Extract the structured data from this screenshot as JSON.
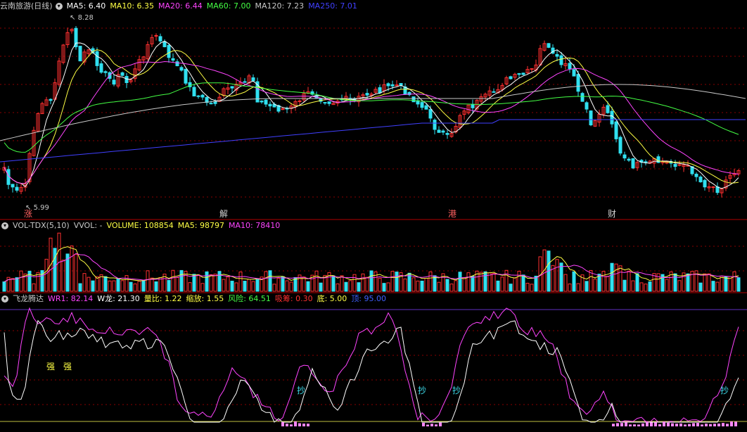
{
  "main": {
    "title": "云南旅游(日线)",
    "ma": [
      {
        "label": "MA5: 6.40",
        "color": "#ffffff"
      },
      {
        "label": "MA10: 6.35",
        "color": "#ffff44"
      },
      {
        "label": "MA20: 6.44",
        "color": "#ff44ff"
      },
      {
        "label": "MA60: 7.00",
        "color": "#44ff44"
      },
      {
        "label": "MA120: 7.23",
        "color": "#c8c8c8"
      },
      {
        "label": "MA250: 7.01",
        "color": "#4040ff"
      }
    ],
    "high_label": "8.28",
    "low_label": "5.99",
    "markers": [
      "涨",
      "解",
      "港",
      "财"
    ]
  },
  "volume": {
    "title": "VOL-TDX(5,10)",
    "vvol": "VVOL: -",
    "volume": "VOLUME: 108854",
    "ma5": "MA5: 98797",
    "ma10": "MA10: 78410"
  },
  "indicator": {
    "title": "飞龙腾达",
    "items": [
      {
        "label": "WR1: 82.14",
        "color": "#ff44ff"
      },
      {
        "label": "W龙: 21.30",
        "color": "#ffffff"
      },
      {
        "label": "量比: 1.22",
        "color": "#ffff44"
      },
      {
        "label": "缩放: 1.55",
        "color": "#ffff44"
      },
      {
        "label": "风险: 64.51",
        "color": "#44ff44"
      },
      {
        "label": "吸筹: 0.30",
        "color": "#ff3030"
      },
      {
        "label": "底: 5.00",
        "color": "#ffff44"
      },
      {
        "label": "顶: 95.00",
        "color": "#4060ff"
      }
    ],
    "strong_labels": [
      "强",
      "强"
    ],
    "signal_labels": [
      "抄",
      "抄",
      "抄",
      "抄"
    ]
  },
  "colors": {
    "up": "#ff3030",
    "down": "#30e0f0",
    "grid": "#8a0000",
    "frame": "#b00000"
  }
}
